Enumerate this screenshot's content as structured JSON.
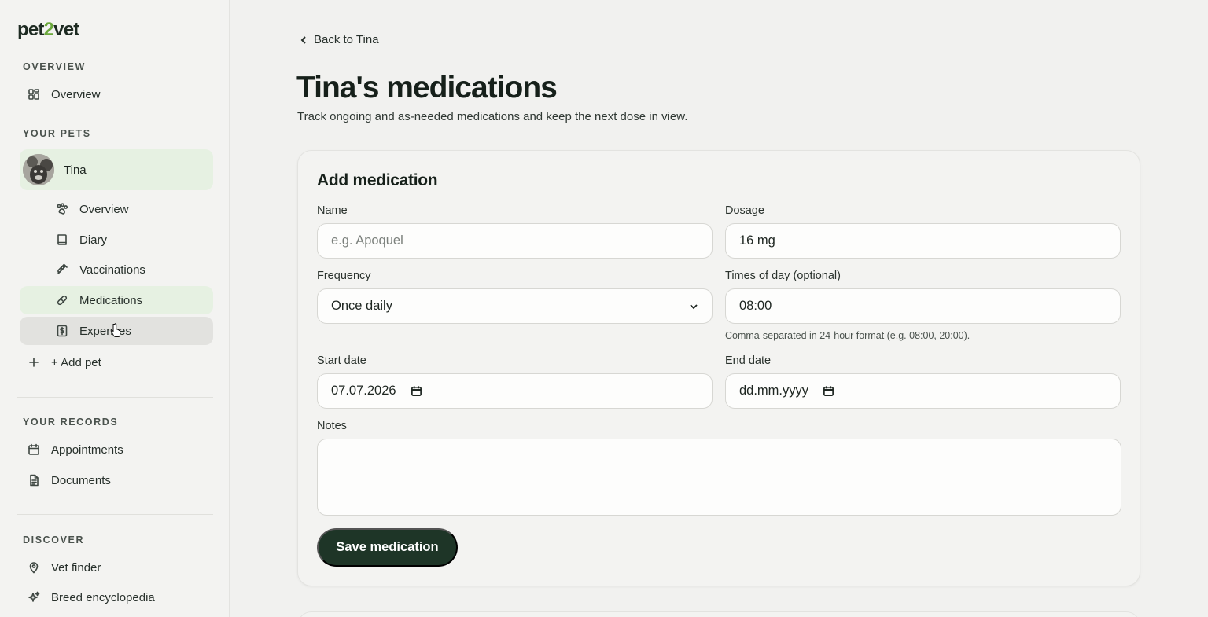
{
  "brand": {
    "logo_pre": "pet",
    "logo_num": "2",
    "logo_post": "vet"
  },
  "sidebar": {
    "overview_section": "OVERVIEW",
    "overview_item": "Overview",
    "pets_section": "YOUR PETS",
    "pet": {
      "name": "Tina",
      "items": [
        {
          "label": "Overview",
          "icon": "paw-icon"
        },
        {
          "label": "Diary",
          "icon": "book-icon"
        },
        {
          "label": "Vaccinations",
          "icon": "syringe-icon"
        },
        {
          "label": "Medications",
          "icon": "pill-icon",
          "active": true
        },
        {
          "label": "Expenses",
          "icon": "dollar-icon",
          "hover": true
        }
      ]
    },
    "add_pet": "+ Add pet",
    "records_section": "YOUR RECORDS",
    "records_items": [
      {
        "label": "Appointments",
        "icon": "calendar-icon"
      },
      {
        "label": "Documents",
        "icon": "document-icon"
      }
    ],
    "discover_section": "DISCOVER",
    "discover_items": [
      {
        "label": "Vet finder",
        "icon": "map-pin-icon"
      },
      {
        "label": "Breed encyclopedia",
        "icon": "sparkles-icon"
      }
    ]
  },
  "main": {
    "back_link": "Back to Tina",
    "title": "Tina's medications",
    "subtitle": "Track ongoing and as-needed medications and keep the next dose in view."
  },
  "form": {
    "heading": "Add medication",
    "name_label": "Name",
    "name_placeholder": "e.g. Apoquel",
    "dosage_label": "Dosage",
    "dosage_value": "16 mg",
    "frequency_label": "Frequency",
    "frequency_value": "Once daily",
    "times_label": "Times of day (optional)",
    "times_value": "08:00",
    "times_helper": "Comma-separated in 24-hour format (e.g. 08:00, 20:00).",
    "start_label": "Start date",
    "start_value": "07.07.2026",
    "end_label": "End date",
    "end_value": "dd.mm.yyyy",
    "notes_label": "Notes",
    "notes_value": "",
    "save_label": "Save medication"
  },
  "colors": {
    "accent": "#1e3527",
    "active_bg": "#e6f1e2",
    "logo_two": "#6aa83b"
  }
}
